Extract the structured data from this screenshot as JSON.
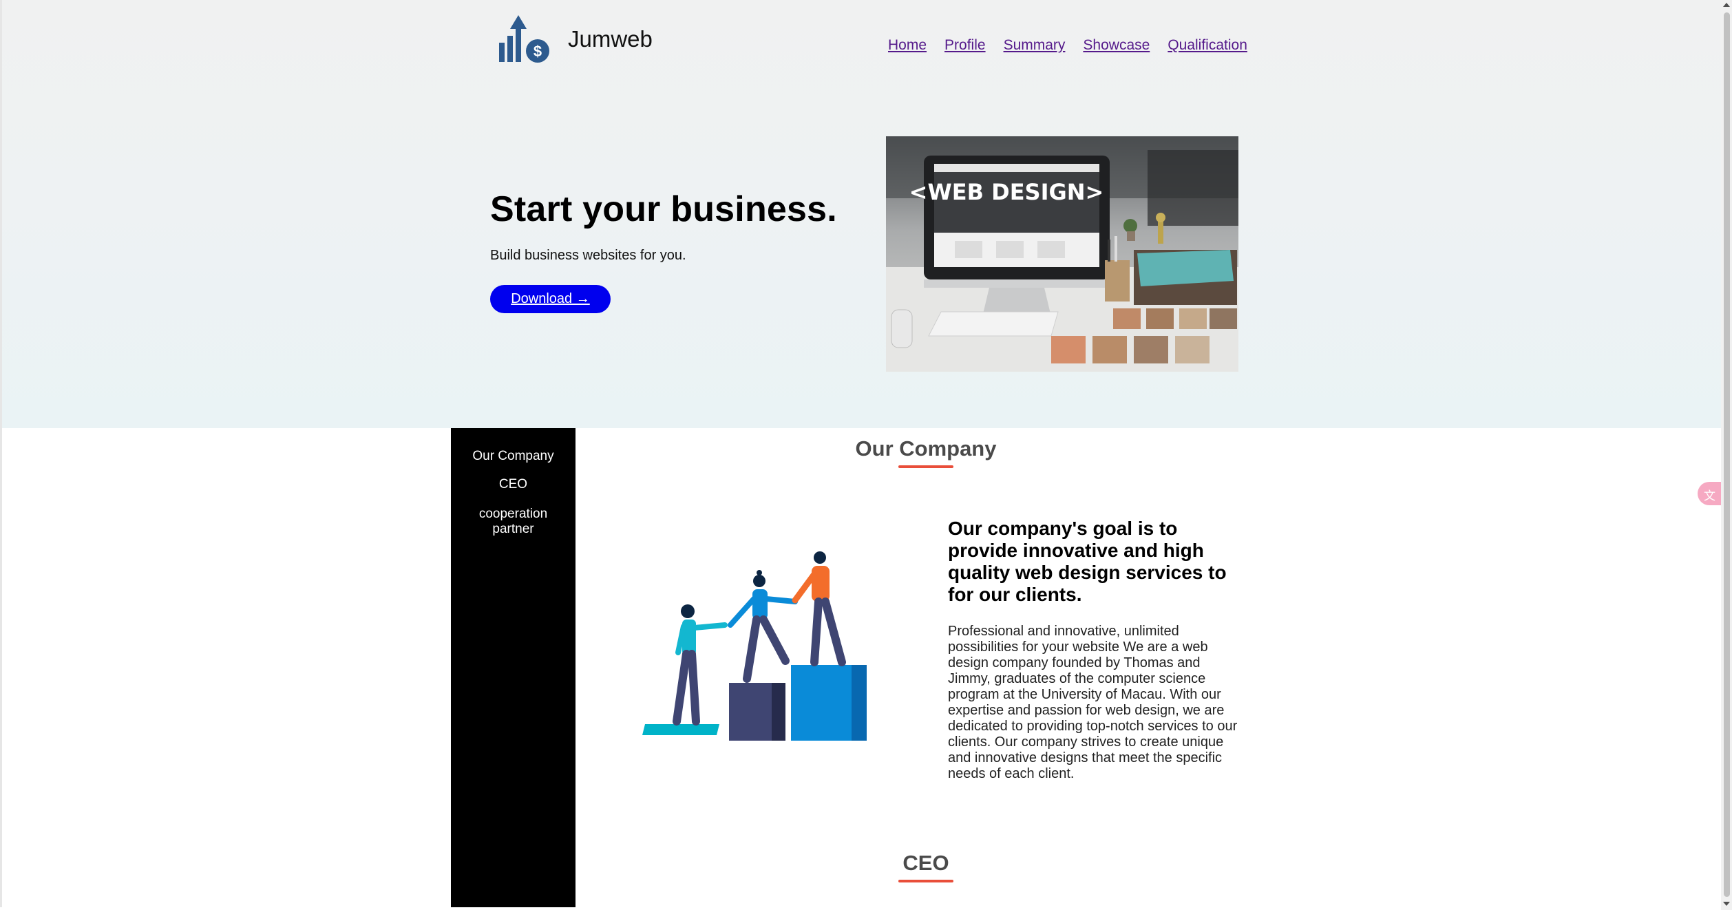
{
  "brand": {
    "name": "Jumweb"
  },
  "nav": {
    "items": [
      "Home",
      "Profile",
      "Summary",
      "Showcase",
      "Qualification"
    ]
  },
  "hero": {
    "title": "Start your business.",
    "subtitle": "Build business websites for you.",
    "download_label": "Download →",
    "image_text": "<WEB DESIGN>"
  },
  "sidebar": {
    "items": [
      "Our Company",
      "CEO",
      "cooperation partner"
    ]
  },
  "company": {
    "title": "Our Company",
    "goal": "Our company's goal is to provide innovative and high quality web design services to for our clients.",
    "description": "Professional and innovative, unlimited possibilities for your website We are a web design company founded by Thomas and Jimmy, graduates of the computer science program at the University of Macau. With our expertise and passion for web design, we are dedicated to providing top-notch services to our clients. Our company strives to create unique and innovative designs that meet the specific needs of each client."
  },
  "ceo": {
    "title": "CEO"
  },
  "widgets": {
    "translate_icon": "translate-icon"
  },
  "colors": {
    "accent_underline": "#e94e3a",
    "button": "#0000ee",
    "sidebar": "#000000",
    "link": "#551a8b"
  }
}
